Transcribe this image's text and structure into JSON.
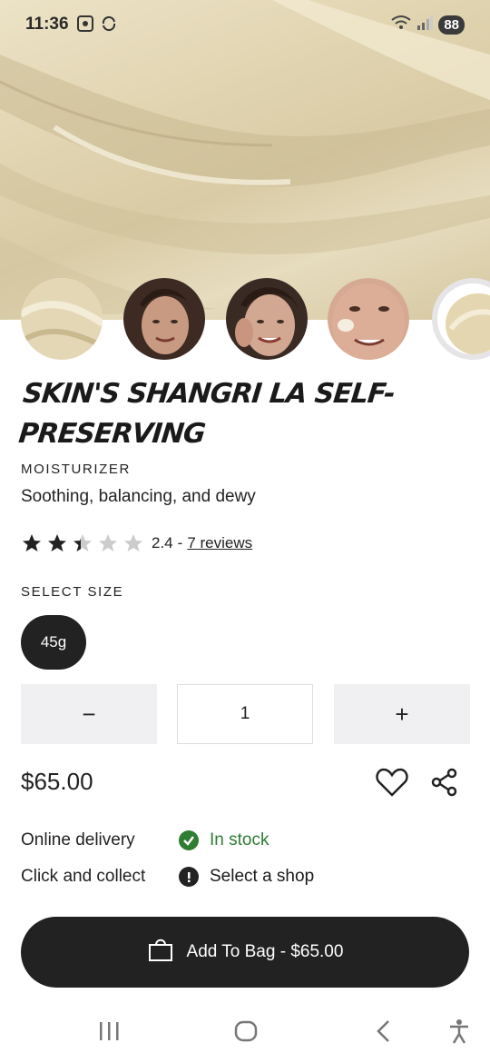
{
  "status": {
    "time": "11:36",
    "battery": "88"
  },
  "hero": {
    "icon": "product-texture-image"
  },
  "thumbnails": [
    {
      "name": "texture-thumb"
    },
    {
      "name": "model-thumb-1"
    },
    {
      "name": "model-thumb-2"
    },
    {
      "name": "model-thumb-3"
    },
    {
      "name": "texture-thumb-partial"
    }
  ],
  "product": {
    "title": "SKIN'S SHANGRI LA SELF-PRESERVING",
    "category": "MOISTURIZER",
    "tagline": "Soothing, balancing, and dewy",
    "rating": 2.4,
    "rating_text": "2.4",
    "rating_separator": "-",
    "reviews_label": "7 reviews"
  },
  "size": {
    "label": "SELECT SIZE",
    "options": [
      "45g"
    ],
    "selected": "45g"
  },
  "quantity": {
    "minus": "−",
    "value": "1",
    "plus": "+"
  },
  "price": "$65.00",
  "availability": [
    {
      "label": "Online delivery",
      "status": "In stock",
      "icon": "check-circle-icon",
      "color": "#2e7d32"
    },
    {
      "label": "Click and collect",
      "status": "Select a shop",
      "icon": "alert-circle-icon",
      "color": "#222222"
    }
  ],
  "cta": {
    "label": "Add To Bag - $65.00",
    "icon": "shopping-bag-icon"
  },
  "colors": {
    "primary": "#222222",
    "success": "#2e7d32",
    "button_bg": "#f0eff1"
  }
}
